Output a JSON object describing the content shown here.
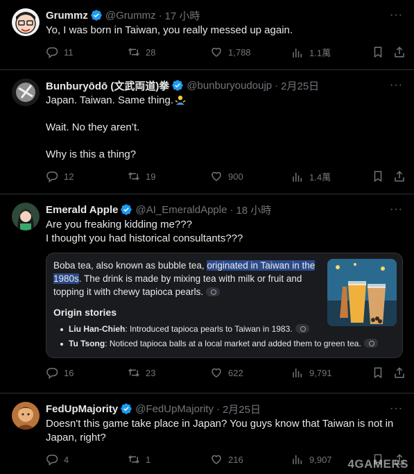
{
  "tweets": [
    {
      "name": "Grummz",
      "handle": "@Grummz",
      "time": "17 小時",
      "text": "Yo, I was born in Taiwan, you really messed up again.",
      "replies": "11",
      "retweets": "28",
      "likes": "1,788",
      "views": "1.1萬"
    },
    {
      "name": "Bunburyōdō (文武両道)拳",
      "handle": "@bunburyoudoujp",
      "time": "2月25日",
      "text": "Japan. Taiwan. Same thing.",
      "text2": "Wait. No they aren’t.",
      "text3": "Why is this a thing?",
      "replies": "12",
      "retweets": "19",
      "likes": "900",
      "views": "1.4萬"
    },
    {
      "name": "Emerald Apple",
      "handle": "@AI_EmeraldApple",
      "time": "18 小時",
      "text": "Are you freaking kidding me???\nI thought you had historical consultants???",
      "card": {
        "intro_before": "Boba tea, also known as bubble tea, ",
        "intro_highlight": "originated in Taiwan in the 1980s",
        "intro_after": ". The drink is made by mixing tea with milk or fruit and topping it with chewy tapioca pearls.",
        "origin_title": "Origin stories",
        "origins": [
          {
            "name": "Liu Han-Chieh",
            "desc": ": Introduced tapioca pearls to Taiwan in 1983."
          },
          {
            "name": "Tu Tsong",
            "desc": ": Noticed tapioca balls at a local market and added them to green tea."
          }
        ]
      },
      "replies": "16",
      "retweets": "23",
      "likes": "622",
      "views": "9,791"
    },
    {
      "name": "FedUpMajority",
      "handle": "@FedUpMajority",
      "time": "2月25日",
      "text": "Doesn't this game take place in Japan? You guys know that Taiwan is not in Japan, right?",
      "replies": "4",
      "retweets": "1",
      "likes": "216",
      "views": "9,907"
    }
  ],
  "watermark": "4GAMERS",
  "colors": {
    "background": "#000000",
    "verified": "#1d9bf0",
    "muted": "#71767b",
    "border": "#2f3336",
    "highlight": "#2c4a8a"
  },
  "icons": [
    "more-icon",
    "verified-icon",
    "reply-icon",
    "retweet-icon",
    "like-icon",
    "views-icon",
    "bookmark-icon",
    "share-icon",
    "link-icon"
  ]
}
